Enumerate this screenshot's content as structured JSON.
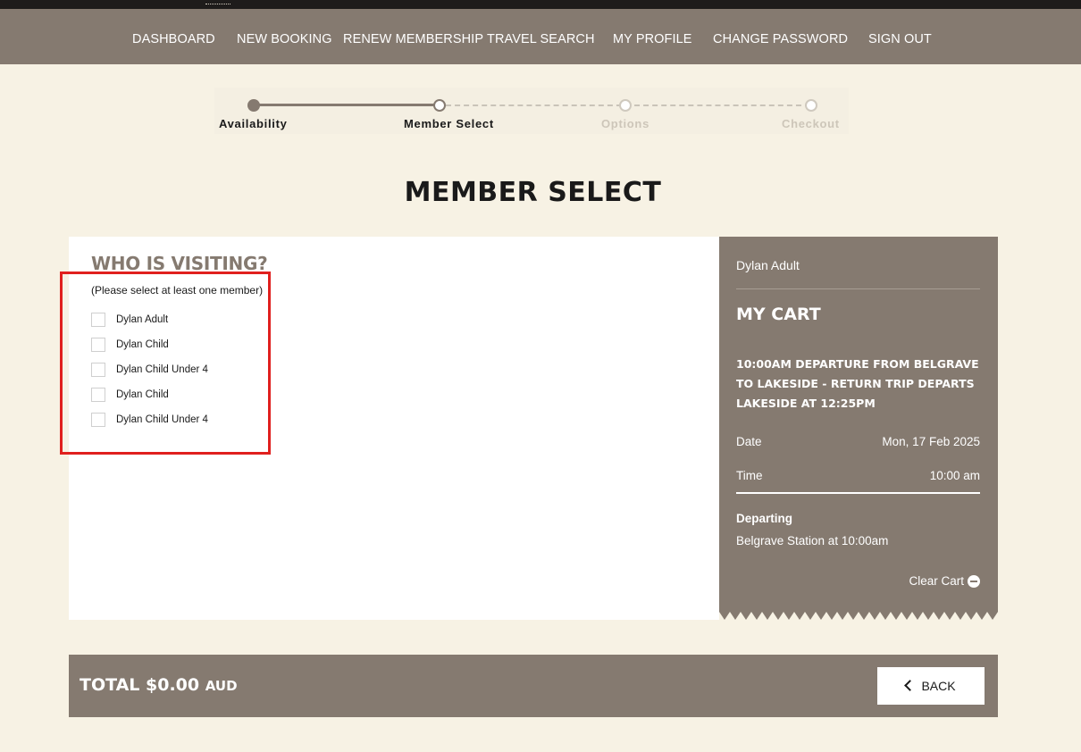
{
  "nav": {
    "items": [
      "DASHBOARD",
      "NEW BOOKING",
      "RENEW MEMBERSHIP",
      "TRAVEL SEARCH",
      "MY PROFILE",
      "CHANGE PASSWORD",
      "SIGN OUT"
    ]
  },
  "stepper": {
    "steps": [
      "Availability",
      "Member Select",
      "Options",
      "Checkout"
    ],
    "current_step": 2
  },
  "page": {
    "title": "MEMBER SELECT"
  },
  "members": {
    "heading": "WHO IS VISITING?",
    "hint": "(Please select at least one member)",
    "list": [
      "Dylan Adult",
      "Dylan Child",
      "Dylan Child Under 4",
      "Dylan Child",
      "Dylan Child Under 4"
    ]
  },
  "cart": {
    "member": "Dylan Adult",
    "title": "MY CART",
    "trip": "10:00AM DEPARTURE FROM BELGRAVE TO LAKESIDE - RETURN TRIP DEPARTS LAKESIDE AT 12:25PM",
    "date_label": "Date",
    "date_value": "Mon, 17 Feb 2025",
    "time_label": "Time",
    "time_value": "10:00 am",
    "departing_label": "Departing",
    "departing_value": "Belgrave Station at 10:00am",
    "clear_label": "Clear Cart"
  },
  "footer": {
    "total_label": "TOTAL $0.00",
    "currency": "AUD",
    "back_label": "BACK"
  },
  "colors": {
    "brand": "#857a70",
    "background": "#f7f2e4",
    "highlight": "#e0201e"
  }
}
